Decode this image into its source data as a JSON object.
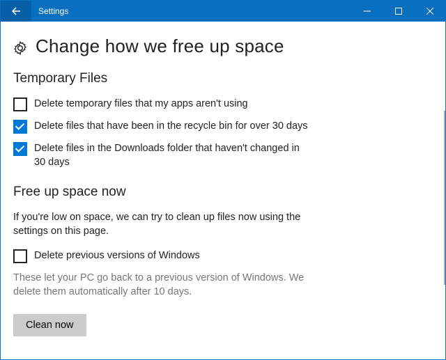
{
  "window": {
    "title": "Settings"
  },
  "page": {
    "title": "Change how we free up space"
  },
  "sections": {
    "temp": {
      "heading": "Temporary Files",
      "options": [
        {
          "label": "Delete temporary files that my apps aren't using",
          "checked": false
        },
        {
          "label": "Delete files that have been in the recycle bin for over 30 days",
          "checked": true
        },
        {
          "label": "Delete files in the Downloads folder that haven't changed in 30 days",
          "checked": true
        }
      ]
    },
    "freeup": {
      "heading": "Free up space now",
      "description": "If you're low on space, we can try to clean up files now using the settings on this page.",
      "option": {
        "label": "Delete previous versions of Windows",
        "checked": false
      },
      "hint": "These let your PC go back to a previous version of Windows. We delete them automatically after 10 days.",
      "button_label": "Clean now"
    }
  }
}
